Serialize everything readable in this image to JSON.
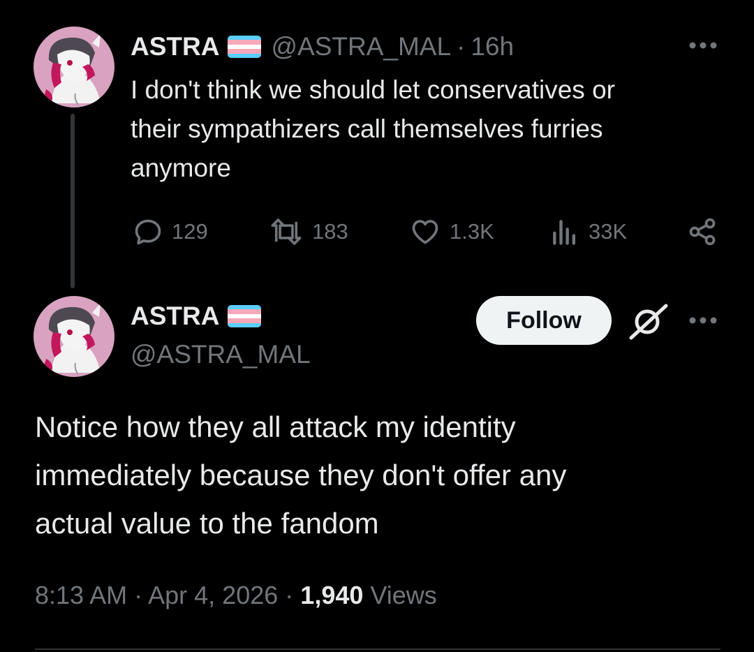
{
  "colors": {
    "background": "#000000",
    "text_primary": "#e7e9ea",
    "text_secondary": "#71767b",
    "thread_line": "#333639",
    "follow_bg": "#eff3f4",
    "flag_blue": "#5bcefa",
    "flag_pink": "#f5a9b8",
    "flag_white": "#ffffff"
  },
  "parent_tweet": {
    "display_name": "ASTRA",
    "handle": "@ASTRA_MAL",
    "separator": "·",
    "age": "16h",
    "more_icon": "more-horizontal-icon",
    "text_lines": [
      "I don't think we should let conservatives or",
      "their sympathizers call themselves furries",
      "anymore"
    ],
    "actions": {
      "replies": "129",
      "reposts": "183",
      "likes": "1.3K",
      "views": "33K"
    }
  },
  "main_tweet": {
    "display_name": "ASTRA",
    "handle": "@ASTRA_MAL",
    "follow_label": "Follow",
    "text_lines": [
      "Notice how they all attack my identity",
      "immediately because they don't offer any",
      "actual value to the fandom"
    ],
    "time": "8:13 AM",
    "sep1": "·",
    "date": "Apr 4, 2026",
    "sep2": "·",
    "views_count": "1,940",
    "views_label": "Views"
  },
  "icons": [
    "reply-icon",
    "repost-icon",
    "like-icon",
    "views-icon",
    "share-icon",
    "grok-icon",
    "more-horizontal-icon",
    "trans-flag-icon"
  ]
}
